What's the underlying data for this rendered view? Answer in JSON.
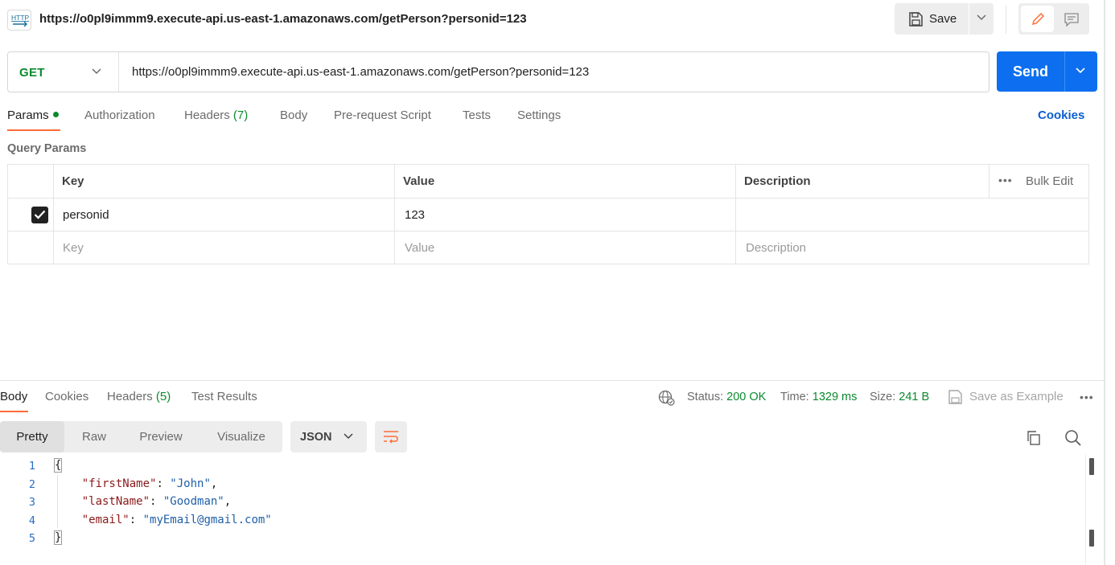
{
  "header": {
    "protocol_badge": "HTTP",
    "request_title": "https://o0pl9immm9.execute-api.us-east-1.amazonaws.com/getPerson?personid=123",
    "save_label": "Save"
  },
  "request": {
    "method": "GET",
    "url": "https://o0pl9immm9.execute-api.us-east-1.amazonaws.com/getPerson?personid=123",
    "send_label": "Send"
  },
  "request_tabs": {
    "params": "Params",
    "authorization": "Authorization",
    "headers": "Headers",
    "headers_count": "(7)",
    "body": "Body",
    "prerequest": "Pre-request Script",
    "tests": "Tests",
    "settings": "Settings",
    "cookies": "Cookies"
  },
  "query_params": {
    "title": "Query Params",
    "columns": {
      "key": "Key",
      "value": "Value",
      "description": "Description"
    },
    "bulk_edit": "Bulk Edit",
    "rows": [
      {
        "checked": true,
        "key": "personid",
        "value": "123",
        "description": ""
      }
    ],
    "placeholders": {
      "key": "Key",
      "value": "Value",
      "description": "Description"
    }
  },
  "response": {
    "tabs": {
      "body": "Body",
      "cookies": "Cookies",
      "headers": "Headers",
      "headers_count": "(5)",
      "test_results": "Test Results"
    },
    "status_label": "Status:",
    "status_value": "200 OK",
    "time_label": "Time:",
    "time_value": "1329 ms",
    "size_label": "Size:",
    "size_value": "241 B",
    "save_example": "Save as Example",
    "views": {
      "pretty": "Pretty",
      "raw": "Raw",
      "preview": "Preview",
      "visualize": "Visualize"
    },
    "format": "JSON",
    "line_numbers": [
      "1",
      "2",
      "3",
      "4",
      "5"
    ],
    "open_brace": "{",
    "close_brace": "}",
    "fields": [
      {
        "key": "\"firstName\"",
        "value": "\"John\"",
        "trail": ","
      },
      {
        "key": "\"lastName\"",
        "value": "\"Goodman\"",
        "trail": ","
      },
      {
        "key": "\"email\"",
        "value": "\"myEmail@gmail.com\"",
        "trail": ""
      }
    ]
  },
  "colors": {
    "accent": "#ff6c37",
    "send": "#0d6ff0",
    "method_get": "#0b8a2f",
    "status_ok": "#0b8a2f"
  },
  "icons": [
    "http-icon",
    "save-icon",
    "chevron-down-icon",
    "edit-icon",
    "comment-icon",
    "checkmark-icon",
    "more-icon",
    "globe-icon",
    "copy-icon",
    "search-icon",
    "wrap-icon"
  ]
}
